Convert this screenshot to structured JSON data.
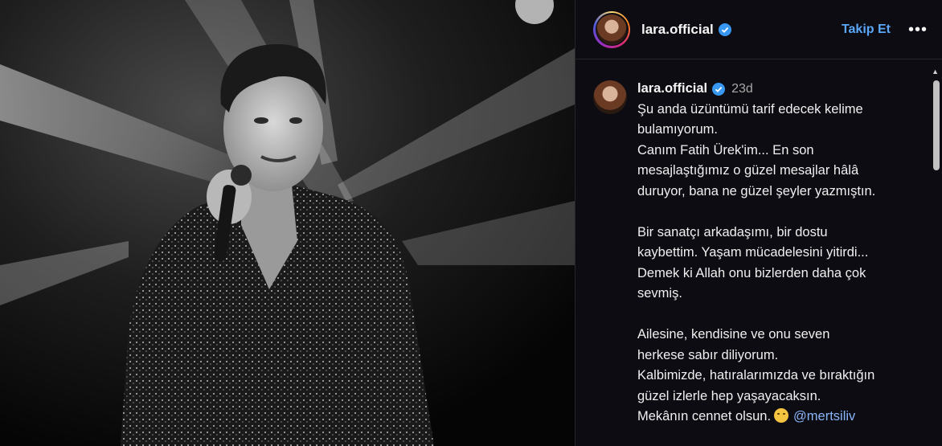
{
  "header": {
    "username": "lara.official",
    "follow_label": "Takip Et",
    "more_label": "•••"
  },
  "comment": {
    "username": "lara.official",
    "time": "23d",
    "lines": [
      "Şu anda üzüntümü tarif edecek kelime",
      "bulamıyorum.",
      "Canım Fatih Ürek'im... En son",
      "mesajlaştığımız o güzel mesajlar hâlâ",
      "duruyor, bana ne güzel şeyler yazmıştın.",
      "",
      "Bir sanatçı arkadaşımı, bir dostu",
      "kaybettim. Yaşam mücadelesini yitirdi...",
      "Demek ki Allah onu bizlerden daha çok",
      "sevmiş.",
      "",
      "Ailesine, kendisine ve onu seven",
      "herkese sabır diliyorum.",
      "Kalbimizde, hatıralarımızda ve bıraktığın",
      "güzel izlerle hep yaşayacaksın."
    ],
    "last_line": "Mekânın cennet olsun.",
    "emoji_name": "sad-face-emoji",
    "mention": "@mertsiliv"
  },
  "colors": {
    "accent": "#5aa7f7",
    "verified": "#3897f0",
    "mention": "#8ab4f8",
    "panel_bg": "#0c0c12"
  }
}
